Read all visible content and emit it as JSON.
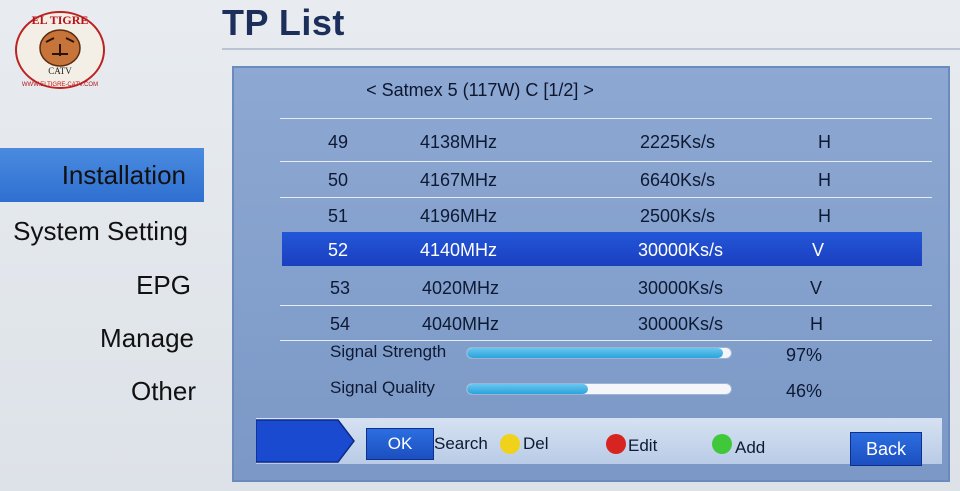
{
  "logo": {
    "name": "EL TIGRE",
    "sub": "CATV",
    "url": "WWW.ELTIGRE-CATV.COM"
  },
  "title": "TP List",
  "sidebar": {
    "items": [
      {
        "label": "Installation",
        "selected": true
      },
      {
        "label": "System Setting",
        "selected": false
      },
      {
        "label": "EPG",
        "selected": false
      },
      {
        "label": "Manage",
        "selected": false
      },
      {
        "label": "Other",
        "selected": false
      }
    ]
  },
  "satellite": {
    "header": "< Satmex 5 (117W) C [1/2] >"
  },
  "transponders": [
    {
      "num": "49",
      "freq": "4138MHz",
      "symbol": "2225Ks/s",
      "pol": "H",
      "selected": false
    },
    {
      "num": "50",
      "freq": "4167MHz",
      "symbol": "6640Ks/s",
      "pol": "H",
      "selected": false
    },
    {
      "num": "51",
      "freq": "4196MHz",
      "symbol": "2500Ks/s",
      "pol": "H",
      "selected": false
    },
    {
      "num": "52",
      "freq": "4140MHz",
      "symbol": "30000Ks/s",
      "pol": "V",
      "selected": true
    },
    {
      "num": "53",
      "freq": "4020MHz",
      "symbol": "30000Ks/s",
      "pol": "V",
      "selected": false
    },
    {
      "num": "54",
      "freq": "4040MHz",
      "symbol": "30000Ks/s",
      "pol": "H",
      "selected": false
    }
  ],
  "signal": {
    "strength_label": "Signal Strength",
    "strength_pct": "97%",
    "strength_value": 0.97,
    "quality_label": "Signal Quality",
    "quality_pct": "46%",
    "quality_value": 0.46
  },
  "footer": {
    "ok_label": "OK",
    "search_label": "Search",
    "del_label": "Del",
    "edit_label": "Edit",
    "add_label": "Add",
    "back_label": "Back",
    "colors": {
      "yellow": "#f0d21a",
      "red": "#d82420",
      "green": "#3fc83a",
      "selection": "#1f4ccc"
    }
  }
}
